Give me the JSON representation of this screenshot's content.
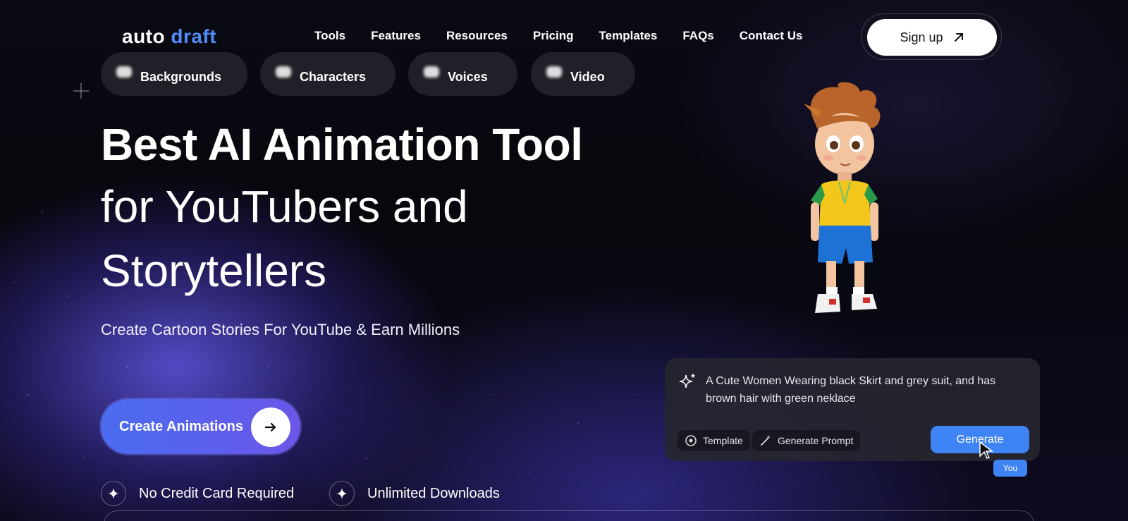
{
  "brand": {
    "part1": "auto",
    "part2": "draft"
  },
  "nav": {
    "links": [
      "Tools",
      "Features",
      "Resources",
      "Pricing",
      "Templates",
      "FAQs",
      "Contact Us"
    ],
    "signup_label": "Sign up"
  },
  "pills": [
    "Backgrounds",
    "Characters",
    "Voices",
    "Video"
  ],
  "hero": {
    "line1": "Best AI Animation Tool",
    "line2": "for YouTubers and",
    "line3": "Storytellers",
    "subtitle": "Create Cartoon Stories For YouTube & Earn Millions",
    "cta_label": "Create Animations"
  },
  "features": [
    "No Credit Card Required",
    "Unlimited Downloads"
  ],
  "prompt_card": {
    "text": "A Cute Women Wearing black Skirt and grey suit, and has brown hair with green neklace",
    "template_label": "Template",
    "generate_prompt_label": "Generate Prompt",
    "generate_label": "Generate",
    "cursor_tag": "You"
  },
  "colors": {
    "accent": "#4f8df9",
    "cta_start": "#4a6cf0",
    "cta_end": "#6b56e8",
    "generate": "#3f84f5"
  }
}
